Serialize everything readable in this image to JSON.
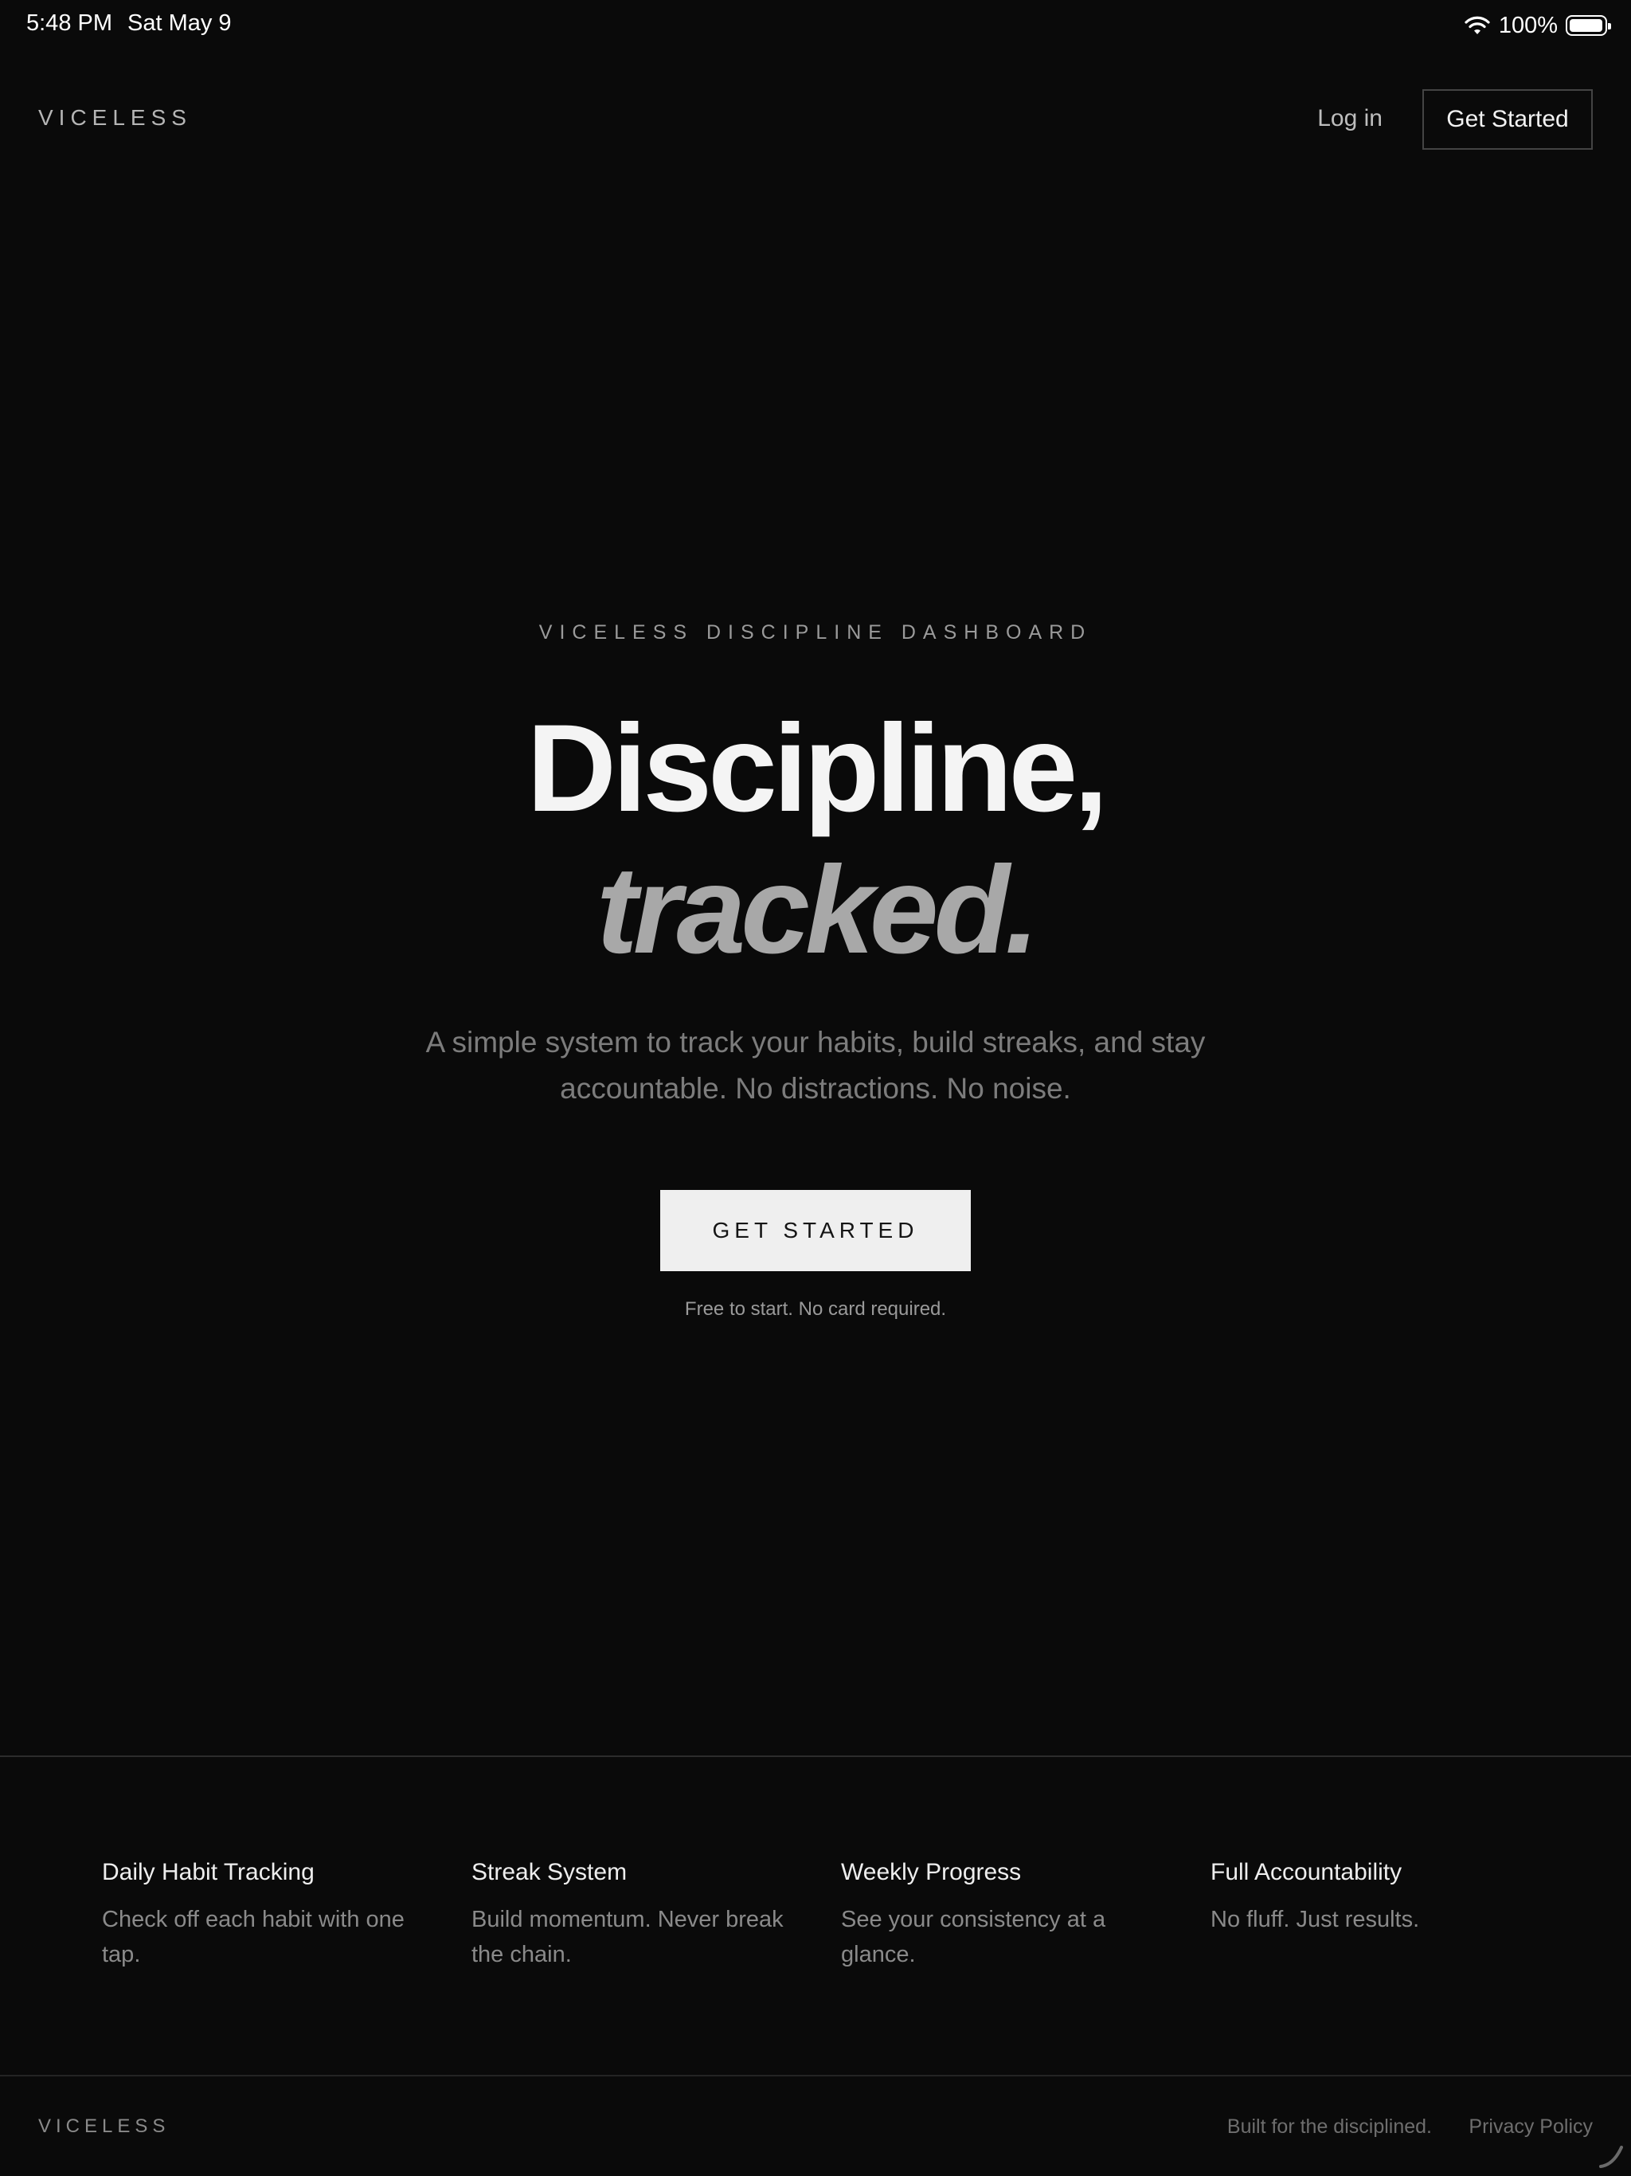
{
  "status_bar": {
    "time": "5:48 PM",
    "date": "Sat May 9",
    "battery_percent": "100%",
    "battery_level": 1.0
  },
  "nav": {
    "brand": "VICELESS",
    "login_label": "Log in",
    "cta_label": "Get Started"
  },
  "hero": {
    "eyebrow": "VICELESS DISCIPLINE DASHBOARD",
    "headline_line1": "Discipline,",
    "headline_line2": "tracked.",
    "subcopy": "A simple system to track your habits, build streaks, and stay accountable. No distractions. No noise.",
    "cta_label": "GET STARTED",
    "note": "Free to start. No card required."
  },
  "features": [
    {
      "title": "Daily Habit Tracking",
      "description": "Check off each habit with one tap."
    },
    {
      "title": "Streak System",
      "description": "Build momentum. Never break the chain."
    },
    {
      "title": "Weekly Progress",
      "description": "See your consistency at a glance."
    },
    {
      "title": "Full Accountability",
      "description": "No fluff. Just results."
    }
  ],
  "footer": {
    "brand": "VICELESS",
    "tagline": "Built for the disciplined.",
    "privacy_label": "Privacy Policy"
  },
  "colors": {
    "background": "#0a0a0a",
    "text_primary": "#f2f2f2",
    "text_muted": "#7c7c7c",
    "accent_button": "#efefef"
  },
  "icons": {
    "wifi": "wifi-icon",
    "battery": "battery-icon"
  }
}
